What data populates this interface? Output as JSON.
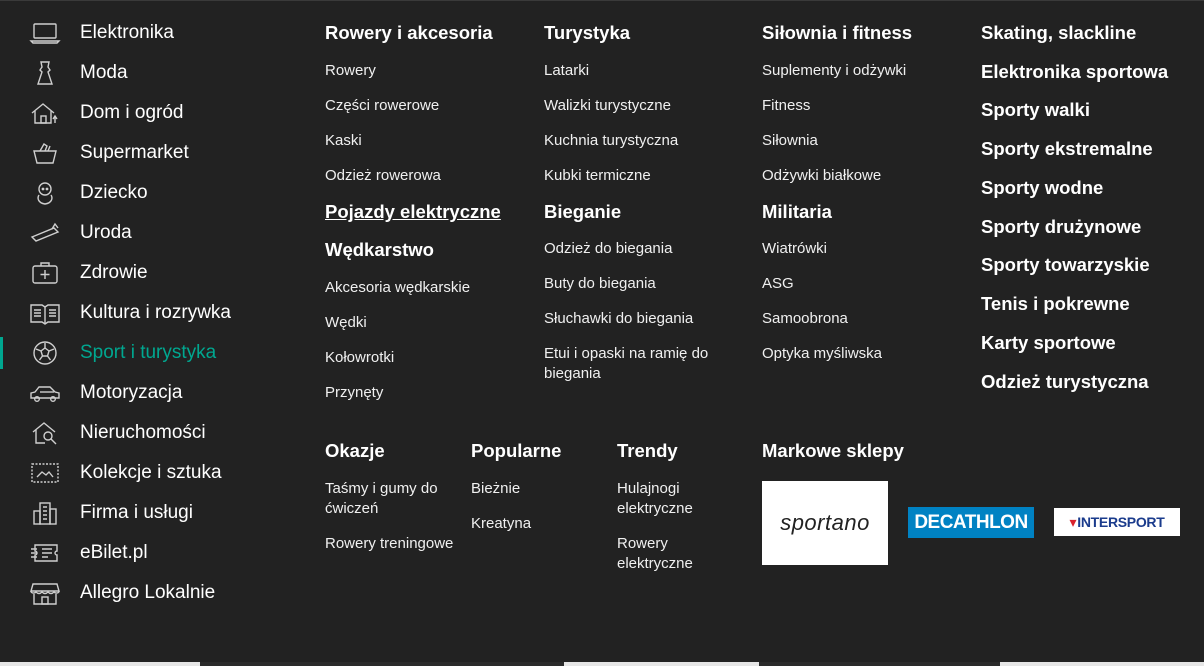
{
  "sidebar": {
    "items": [
      {
        "label": "Elektronika",
        "icon": "laptop-icon"
      },
      {
        "label": "Moda",
        "icon": "dress-icon"
      },
      {
        "label": "Dom i ogród",
        "icon": "house-icon"
      },
      {
        "label": "Supermarket",
        "icon": "basket-icon"
      },
      {
        "label": "Dziecko",
        "icon": "baby-icon"
      },
      {
        "label": "Uroda",
        "icon": "lipstick-icon"
      },
      {
        "label": "Zdrowie",
        "icon": "first-aid-icon"
      },
      {
        "label": "Kultura i rozrywka",
        "icon": "book-icon"
      },
      {
        "label": "Sport i turystyka",
        "icon": "football-icon",
        "active": true
      },
      {
        "label": "Motoryzacja",
        "icon": "car-icon"
      },
      {
        "label": "Nieruchomości",
        "icon": "house-search-icon"
      },
      {
        "label": "Kolekcje i sztuka",
        "icon": "stamp-icon"
      },
      {
        "label": "Firma i usługi",
        "icon": "office-building-icon"
      },
      {
        "label": "eBilet.pl",
        "icon": "ticket-icon"
      },
      {
        "label": "Allegro Lokalnie",
        "icon": "shop-icon"
      }
    ]
  },
  "col1": {
    "h1": "Rowery i akcesoria",
    "links1": [
      "Rowery",
      "Części rowerowe",
      "Kaski",
      "Odzież rowerowa"
    ],
    "h2": "Pojazdy elektryczne",
    "h3": "Wędkarstwo",
    "links3": [
      "Akcesoria wędkarskie",
      "Wędki",
      "Kołowrotki",
      "Przynęty"
    ]
  },
  "col2": {
    "h1": "Turystyka",
    "links1": [
      "Latarki",
      "Walizki turystyczne",
      "Kuchnia turystyczna",
      "Kubki termiczne"
    ],
    "h2": "Bieganie",
    "links2": [
      "Odzież do biegania",
      "Buty do biegania",
      "Słuchawki do biegania",
      "Etui i opaski na ramię do biegania"
    ]
  },
  "col3": {
    "h1": "Siłownia i fitness",
    "links1": [
      "Suplementy i odżywki",
      "Fitness",
      "Siłownia",
      "Odżywki białkowe"
    ],
    "h2": "Militaria",
    "links2": [
      "Wiatrówki",
      "ASG",
      "Samoobrona",
      "Optyka myśliwska"
    ]
  },
  "col4": {
    "headings": [
      "Skating, slackline",
      "Elektronika sportowa",
      "Sporty walki",
      "Sporty ekstremalne",
      "Sporty wodne",
      "Sporty drużynowe",
      "Sporty towarzyskie",
      "Tenis i pokrewne",
      "Karty sportowe",
      "Odzież turystyczna"
    ]
  },
  "bottom": {
    "okazje": {
      "title": "Okazje",
      "links": [
        "Taśmy i gumy do ćwiczeń",
        "Rowery treningowe"
      ]
    },
    "popularne": {
      "title": "Popularne",
      "links": [
        "Bieżnie",
        "Kreatyna"
      ]
    },
    "trendy": {
      "title": "Trendy",
      "links": [
        "Hulajnogi elektryczne",
        "Rowery elektryczne"
      ]
    },
    "brands": {
      "title": "Markowe sklepy",
      "sportano": "sportano",
      "decathlon": "DECATHLON",
      "intersport": "INTERSPORT"
    }
  },
  "colors": {
    "background": "#222222",
    "accent": "#00a790",
    "text": "#ffffff",
    "decathlon": "#0082c3"
  }
}
